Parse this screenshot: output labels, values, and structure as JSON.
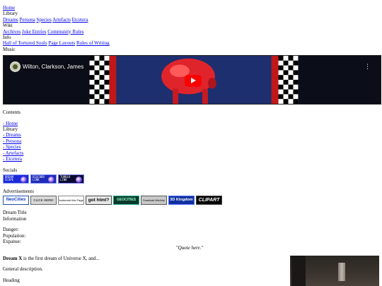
{
  "nav": {
    "home": "Home",
    "library_heading": "Library",
    "library_links": [
      "Dreams",
      "Persona",
      "Species",
      "Artefacts",
      "Etcetera"
    ],
    "wiki_heading": "Wiki",
    "wiki_links": [
      "Archives",
      "Joke Entries",
      "Community Rules"
    ],
    "info_heading": "Info",
    "info_links": [
      "Hall of Tortured Souls",
      "Page Layouts",
      "Rules of Writing"
    ],
    "music_heading": "Music"
  },
  "video": {
    "channel_title": "Wilton, Clarkson, James",
    "menu_icon": "more-vertical-icon",
    "play_icon": "youtube-play-icon"
  },
  "contents": {
    "heading": "Contents",
    "home": "- Home",
    "library_heading": "Library",
    "items": [
      "- Dreams",
      "- Persona",
      "- Species",
      "- Artefacts",
      "- Etcetera"
    ]
  },
  "socials": {
    "heading": "Socials",
    "badges": [
      {
        "line1": "DREAM",
        "line2": "SCAPE"
      },
      {
        "line1": "DISCORD",
        "line2": "LINK"
      },
      {
        "line1": "TUMBLR",
        "line2": "LINK"
      }
    ]
  },
  "advertisements": {
    "heading": "Advertisements",
    "ads": [
      "NeoCities",
      "CLICK HERE!",
      "Bookmark this Page!",
      "got html?",
      "GEOCITIES",
      "Download WinAmp",
      "3D Kingdom",
      "CLIPART"
    ]
  },
  "dream": {
    "title": "Dream Title",
    "information": "Information",
    "danger_label": "Danger:",
    "population_label": "Population:",
    "expanse_label": "Expanse:",
    "quote": "\"Quote here.\"",
    "intro_bold": "Dream X",
    "intro_rest": " is the first dream of Universe X, and...",
    "general": "General description.",
    "heading": "Heading"
  }
}
